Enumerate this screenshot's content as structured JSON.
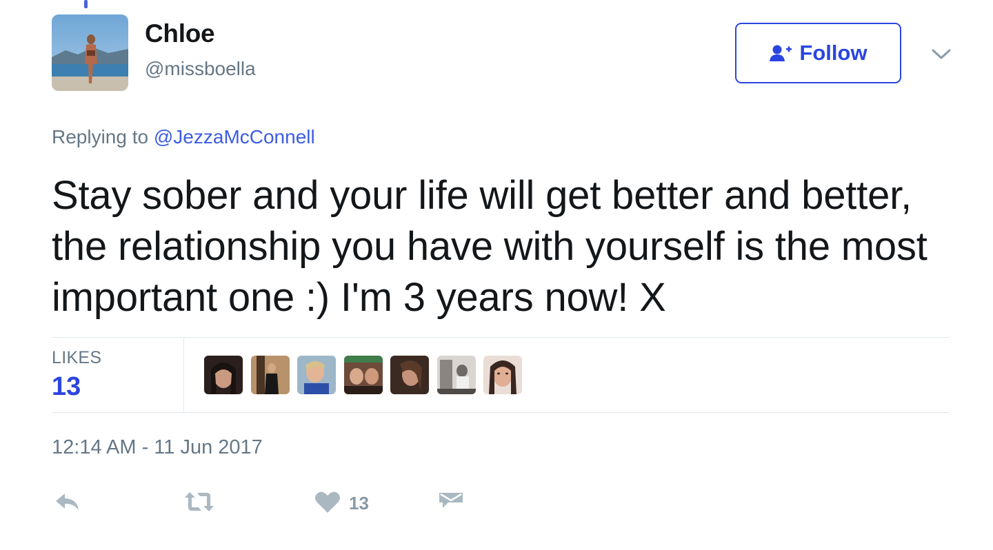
{
  "tweet": {
    "author": {
      "display_name": "Chloe",
      "handle": "@missboella"
    },
    "follow_label": "Follow",
    "replying_prefix": "Replying to",
    "replying_to": "@JezzaMcConnell",
    "text": "Stay sober and your life will get better and better, the relationship you have with yourself is the most important one :) I'm 3 years now! X",
    "stats": {
      "likes_label": "LIKES",
      "likes_count": "13"
    },
    "timestamp": "12:14 AM - 11 Jun 2017",
    "actions": {
      "like_count": "13"
    }
  },
  "icons": {
    "follow": "follow-user-icon",
    "more": "chevron-down-icon",
    "reply": "reply-icon",
    "retweet": "retweet-icon",
    "like": "heart-icon",
    "dm": "direct-message-icon"
  },
  "colors": {
    "accent": "#2a45e0",
    "secondary_text": "#657786",
    "action_icon": "#aab8c2"
  }
}
